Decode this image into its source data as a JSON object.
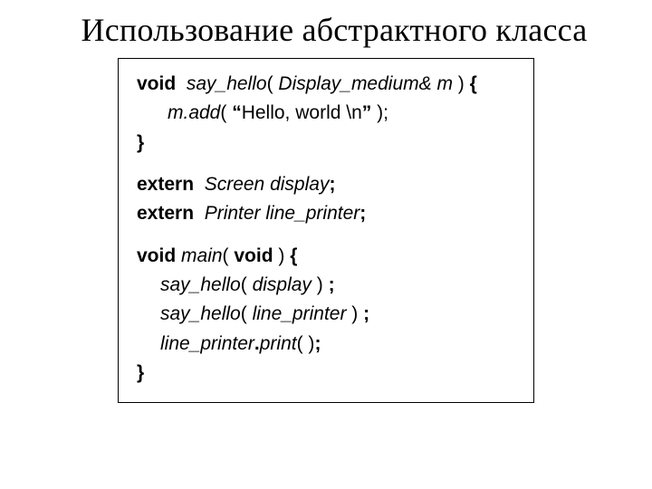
{
  "title": "Использование абстрактного класса",
  "code": {
    "l1": {
      "void": "void",
      "sp1": "  ",
      "fn": "say_hello",
      "lp": "( ",
      "arg": "Display_medium& m",
      "rp": " ) ",
      "brace": "{"
    },
    "l2": {
      "obj": "m.add",
      "lp": "( ",
      "q1": "“",
      "str": "Hello, world \\n",
      "q2": "”",
      "rp": " );"
    },
    "l3": {
      "brace": "}"
    },
    "l4": {
      "extern": "extern",
      "sp": "  ",
      "decl": "Screen display",
      "semi": ";"
    },
    "l5": {
      "extern": "extern",
      "sp": "  ",
      "decl": "Printer line_printer",
      "semi": ";"
    },
    "l6": {
      "void": "void",
      "sp": " ",
      "fn": "main",
      "lp": "( ",
      "param": "void",
      "rp": " ) ",
      "brace": "{"
    },
    "l7": {
      "fn": "say_hello",
      "lp": "( ",
      "arg": "display",
      "rp": " ) ",
      "semi": ";"
    },
    "l8": {
      "fn": "say_hello",
      "lp": "( ",
      "arg": "line_printer",
      "rp": " ) ",
      "semi": ";"
    },
    "l9": {
      "obj": "line_printer",
      "dot": ".",
      "meth": "print",
      "lp": "( )",
      "semi": ";"
    },
    "l10": {
      "brace": "}"
    }
  }
}
